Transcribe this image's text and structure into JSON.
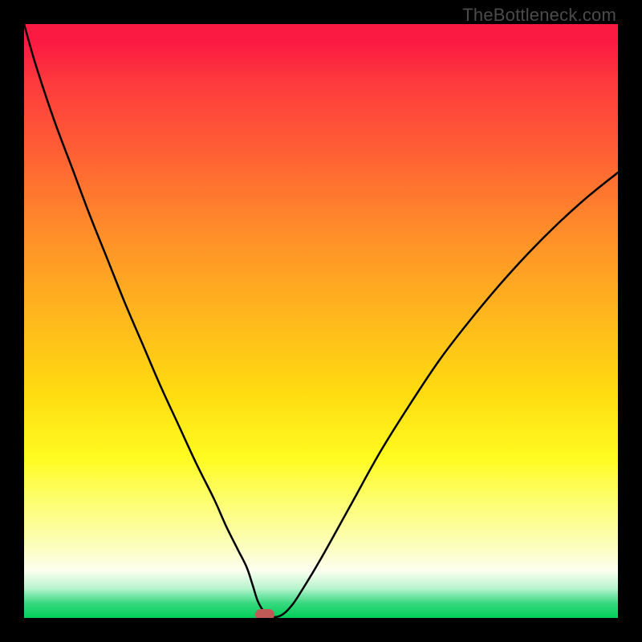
{
  "watermark": {
    "text": "TheBottleneck.com"
  },
  "chart_data": {
    "type": "line",
    "title": "",
    "xlabel": "",
    "ylabel": "",
    "xlim": [
      0,
      100
    ],
    "ylim": [
      0,
      100
    ],
    "grid": false,
    "series": [
      {
        "name": "bottleneck-curve",
        "x": [
          0,
          2,
          5,
          8,
          11,
          14,
          17,
          20,
          23,
          26,
          29,
          32,
          34,
          36,
          37.5,
          38.5,
          39.5,
          41,
          43,
          45,
          47,
          50,
          55,
          60,
          65,
          70,
          75,
          80,
          85,
          90,
          95,
          100
        ],
        "values": [
          100,
          93,
          84,
          76,
          68,
          60.5,
          53,
          46,
          39,
          32.5,
          26,
          20,
          15.5,
          11.5,
          8.5,
          5.5,
          2.5,
          0.5,
          0.3,
          2,
          5,
          10,
          19,
          28,
          36,
          43.5,
          50,
          56,
          61.5,
          66.5,
          71,
          75
        ]
      }
    ],
    "marker": {
      "x": 40.5,
      "y": 0.5,
      "color": "#c05a57"
    },
    "background_gradient": {
      "top": "#fb1a42",
      "mid": "#ffdb10",
      "bottom": "#00cf58"
    }
  }
}
